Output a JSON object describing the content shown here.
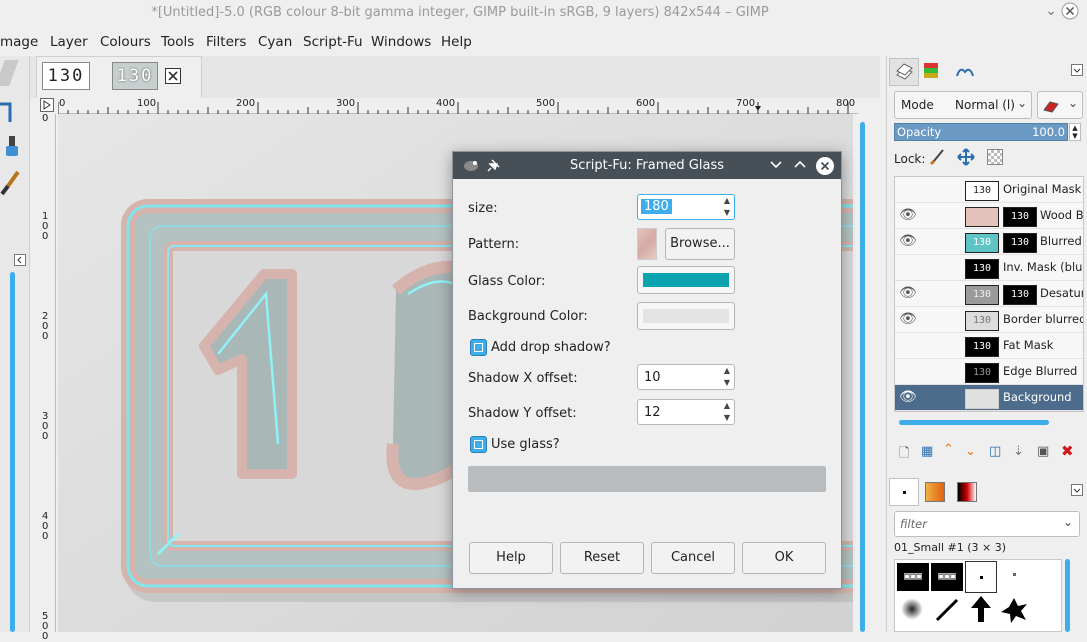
{
  "window": {
    "title": "*[Untitled]-5.0 (RGB colour 8-bit gamma integer, GIMP built-in sRGB, 9 layers) 842x544 – GIMP"
  },
  "menubar": [
    "mage",
    "Layer",
    "Colours",
    "Tools",
    "Filters",
    "Cyan",
    "Script-Fu",
    "Windows",
    "Help"
  ],
  "image_tabs": [
    {
      "label": "130"
    },
    {
      "label": "130"
    }
  ],
  "rulers": {
    "horizontal": [
      "0",
      "100",
      "200",
      "300",
      "400",
      "500",
      "600",
      "700",
      "800"
    ],
    "vertical": [
      "0",
      "100",
      "200",
      "300",
      "400",
      "500"
    ]
  },
  "dialog": {
    "title": "Script-Fu: Framed Glass",
    "size_label": "size:",
    "size_value": "180",
    "pattern_label": "Pattern:",
    "browse_label": "Browse...",
    "glass_color_label": "Glass Color:",
    "glass_color": "#0ba3b0",
    "background_color_label": "Background Color:",
    "background_color": "#e4e4e4",
    "add_drop_shadow_label": "Add drop shadow?",
    "add_drop_shadow_checked": true,
    "shadow_x_label": "Shadow X offset:",
    "shadow_x_value": "10",
    "shadow_y_label": "Shadow Y offset:",
    "shadow_y_value": "12",
    "use_glass_label": "Use glass?",
    "use_glass_checked": true,
    "buttons": {
      "help": "Help",
      "reset": "Reset",
      "cancel": "Cancel",
      "ok": "OK"
    }
  },
  "layers_panel": {
    "mode_label": "Mode",
    "mode_value": "Normal (l)",
    "opacity_label": "Opacity",
    "opacity_value": "100.0",
    "lock_label": "Lock:",
    "layers": [
      {
        "name": "Original Mask",
        "visible": false,
        "thumb": "130",
        "mask": ""
      },
      {
        "name": "Wood Bo",
        "visible": true,
        "thumb": "",
        "mask": "130"
      },
      {
        "name": "Blurred",
        "visible": true,
        "thumb": "130",
        "mask": "130"
      },
      {
        "name": "Inv. Mask (blur",
        "visible": false,
        "thumb": "130",
        "mask": ""
      },
      {
        "name": "Desatura",
        "visible": true,
        "thumb": "130",
        "mask": "130"
      },
      {
        "name": "Border blurred",
        "visible": true,
        "thumb": "130",
        "mask": ""
      },
      {
        "name": "Fat Mask",
        "visible": false,
        "thumb": "130",
        "mask": ""
      },
      {
        "name": "Edge Blurred",
        "visible": false,
        "thumb": "130",
        "mask": ""
      },
      {
        "name": "Background",
        "visible": true,
        "thumb": "",
        "mask": "",
        "selected": true
      }
    ]
  },
  "brushes_panel": {
    "filter_placeholder": "filter",
    "brush_name": "01_Small #1 (3 × 3)"
  },
  "colors": {
    "accent": "#3daee9",
    "dialog_title_bg": "#475057",
    "selected_layer_bg": "#4d6c8c"
  }
}
